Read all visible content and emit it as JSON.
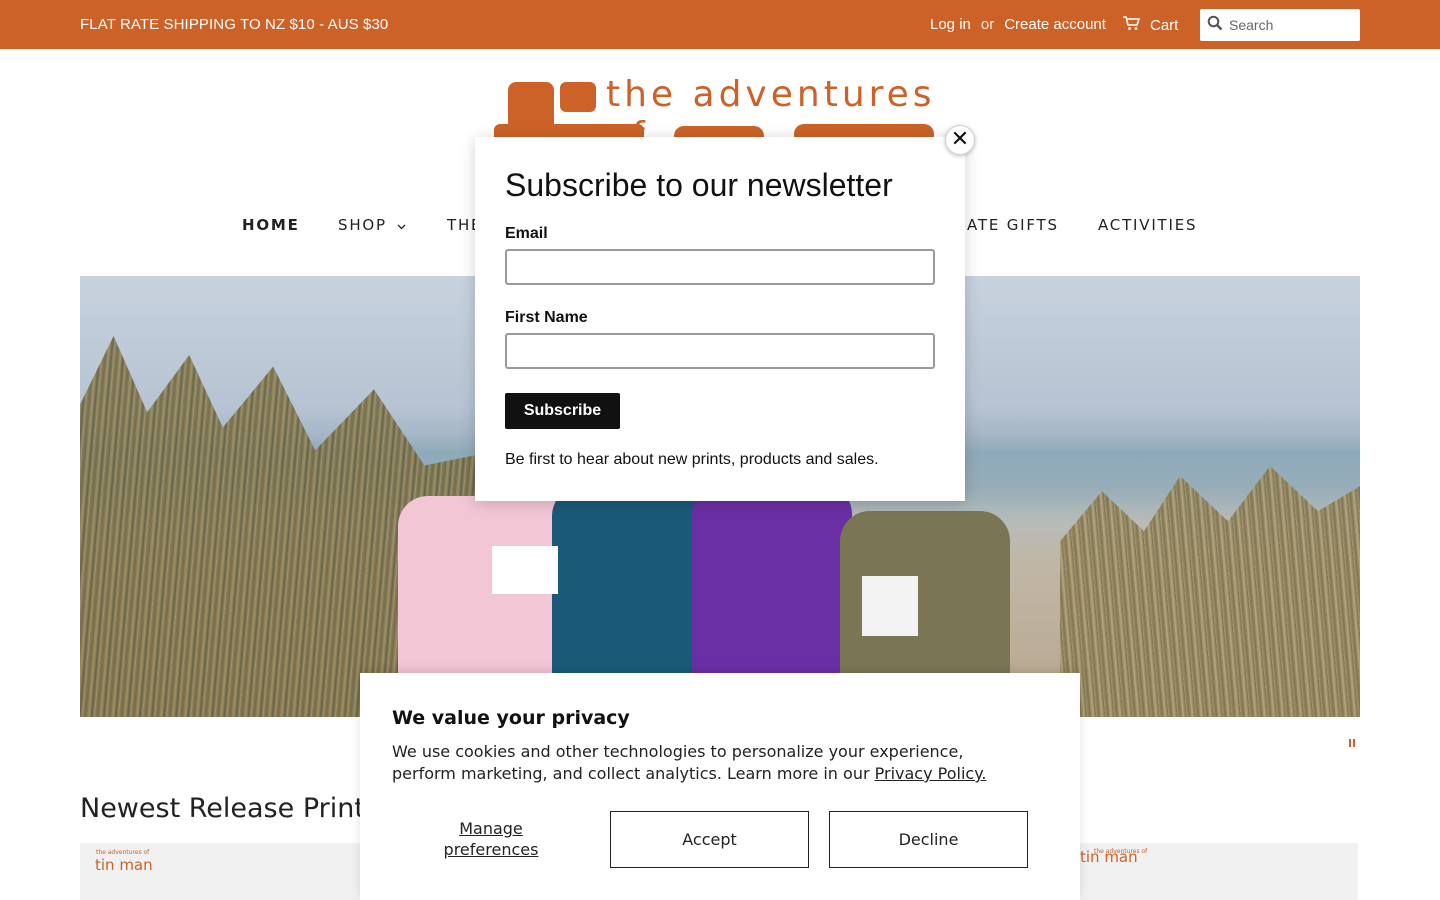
{
  "announcement": {
    "shipping": "FLAT RATE SHIPPING TO NZ $10 - AUS $30",
    "login": "Log in",
    "or": "or",
    "create_account": "Create account",
    "cart": "Cart",
    "search_placeholder": "Search",
    "bar_color": "#cc6227"
  },
  "logo": {
    "text": "the adventures of"
  },
  "nav": {
    "items": [
      "HOME",
      "SHOP",
      "THE",
      "ATE GIFTS",
      "ACTIVITIES"
    ],
    "active": "HOME"
  },
  "section": {
    "title": "Newest Release Prints",
    "card_brand": "the adventures of",
    "card_brand_name": "tin man"
  },
  "newsletter": {
    "title": "Subscribe to our newsletter",
    "email_label": "Email",
    "first_name_label": "First Name",
    "subscribe": "Subscribe",
    "note": "Be first to hear about new prints, products and sales.",
    "close": "✕"
  },
  "privacy": {
    "title": "We value your privacy",
    "body": "We use cookies and other technologies to personalize your experience, perform marketing, and collect analytics. Learn more in our ",
    "link": "Privacy Policy.",
    "manage_line1": "Manage",
    "manage_line2": "preferences",
    "accept": "Accept",
    "decline": "Decline"
  }
}
